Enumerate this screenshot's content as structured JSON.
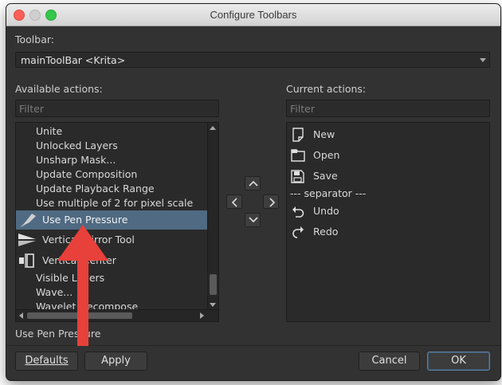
{
  "window": {
    "title": "Configure Toolbars"
  },
  "toolbar": {
    "label": "Toolbar:",
    "selected": "mainToolBar <Krita>"
  },
  "available": {
    "label": "Available actions:",
    "filter_placeholder": "Filter",
    "items": [
      {
        "label": "Unite",
        "icon": ""
      },
      {
        "label": "Unlocked Layers",
        "icon": ""
      },
      {
        "label": "Unsharp Mask...",
        "icon": ""
      },
      {
        "label": "Update Composition",
        "icon": ""
      },
      {
        "label": "Update Playback Range",
        "icon": ""
      },
      {
        "label": "Use multiple of 2 for pixel scale",
        "icon": ""
      },
      {
        "label": "Use Pen Pressure",
        "icon": "pen-pressure-icon",
        "selected": true
      },
      {
        "label": "Vertical Mirror Tool",
        "icon": "vertical-mirror-icon"
      },
      {
        "label": "Vertical Center",
        "icon": "vertical-center-icon"
      },
      {
        "label": "Visible Layers",
        "icon": ""
      },
      {
        "label": "Wave...",
        "icon": ""
      },
      {
        "label": "Wavelet Decompose",
        "icon": ""
      }
    ]
  },
  "current": {
    "label": "Current actions:",
    "filter_placeholder": "Filter",
    "items": [
      {
        "label": "New",
        "icon": "new-document-icon"
      },
      {
        "label": "Open",
        "icon": "folder-icon"
      },
      {
        "label": "Save",
        "icon": "save-icon"
      },
      {
        "label": "--- separator ---",
        "icon": ""
      },
      {
        "label": "Undo",
        "icon": "undo-icon"
      },
      {
        "label": "Redo",
        "icon": "redo-icon"
      }
    ]
  },
  "move_buttons": {
    "up": "chevron-up-icon",
    "left": "chevron-left-icon",
    "right": "chevron-right-icon",
    "down": "chevron-down-icon"
  },
  "status_text": "Use Pen Pressure",
  "buttons": {
    "defaults": "Defaults",
    "apply": "Apply",
    "cancel": "Cancel",
    "ok": "OK"
  },
  "colors": {
    "window_bg": "#323232",
    "selection": "#4f6a82",
    "annotation_arrow": "#e8403a",
    "default_button_border": "#5c7fa0"
  }
}
